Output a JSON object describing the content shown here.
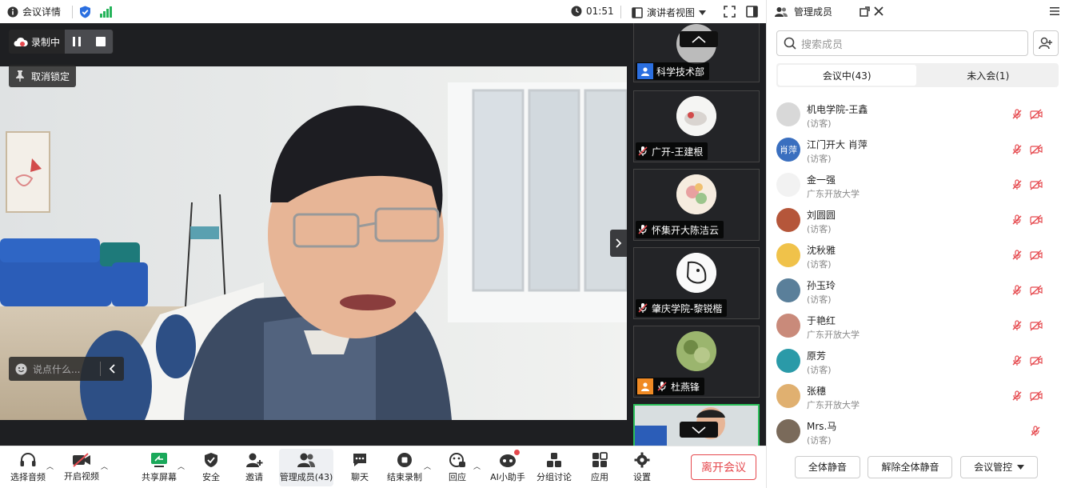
{
  "topbar": {
    "meeting_details": "会议详情",
    "timer": "01:51",
    "view_label": "演讲者视图"
  },
  "stage": {
    "recording_label": "录制中",
    "unpin_label": "取消锁定",
    "chat_placeholder": "说点什么..."
  },
  "strip": {
    "tiles": [
      {
        "name": "科学技术部"
      },
      {
        "name": "广开-王建根"
      },
      {
        "name": "怀集开大陈洁云"
      },
      {
        "name": "肇庆学院-黎锐楷"
      },
      {
        "name": "杜燕锋"
      }
    ]
  },
  "panel": {
    "title": "管理成员",
    "search_placeholder": "搜索成员",
    "tab_in_meeting": "会议中(43)",
    "tab_not_joined": "未入会(1)",
    "members": [
      {
        "name": "机电学院-王鑫",
        "role": "(访客)",
        "avatar_text": ""
      },
      {
        "name": "江门开大 肖萍",
        "role": "(访客)",
        "avatar_text": "肖萍"
      },
      {
        "name": "金一强",
        "role": "广东开放大学",
        "avatar_text": ""
      },
      {
        "name": "刘圆圆",
        "role": "(访客)",
        "avatar_text": ""
      },
      {
        "name": "沈秋雅",
        "role": "(访客)",
        "avatar_text": ""
      },
      {
        "name": "孙玉玲",
        "role": "(访客)",
        "avatar_text": ""
      },
      {
        "name": "于艳红",
        "role": "广东开放大学",
        "avatar_text": ""
      },
      {
        "name": "原芳",
        "role": "(访客)",
        "avatar_text": ""
      },
      {
        "name": "张穗",
        "role": "广东开放大学",
        "avatar_text": ""
      },
      {
        "name": "Mrs.马",
        "role": "(访客)",
        "avatar_text": ""
      }
    ],
    "mute_all": "全体静音",
    "unmute_all": "解除全体静音",
    "meeting_control": "会议管控"
  },
  "toolbar": {
    "audio": "选择音频",
    "video": "开启视频",
    "share": "共享屏幕",
    "security": "安全",
    "invite": "邀请",
    "members": "管理成员(43)",
    "chat": "聊天",
    "end_record": "结束录制",
    "react": "回应",
    "ai": "AI小助手",
    "breakout": "分组讨论",
    "apps": "应用",
    "settings": "设置",
    "leave": "离开会议"
  },
  "colors": {
    "accent_blue": "#2b6fe0",
    "signal_green": "#25b35a",
    "leave_red": "#e5484d",
    "mic_off_red": "#e5484d",
    "active_tile_border": "#2bc05a"
  }
}
